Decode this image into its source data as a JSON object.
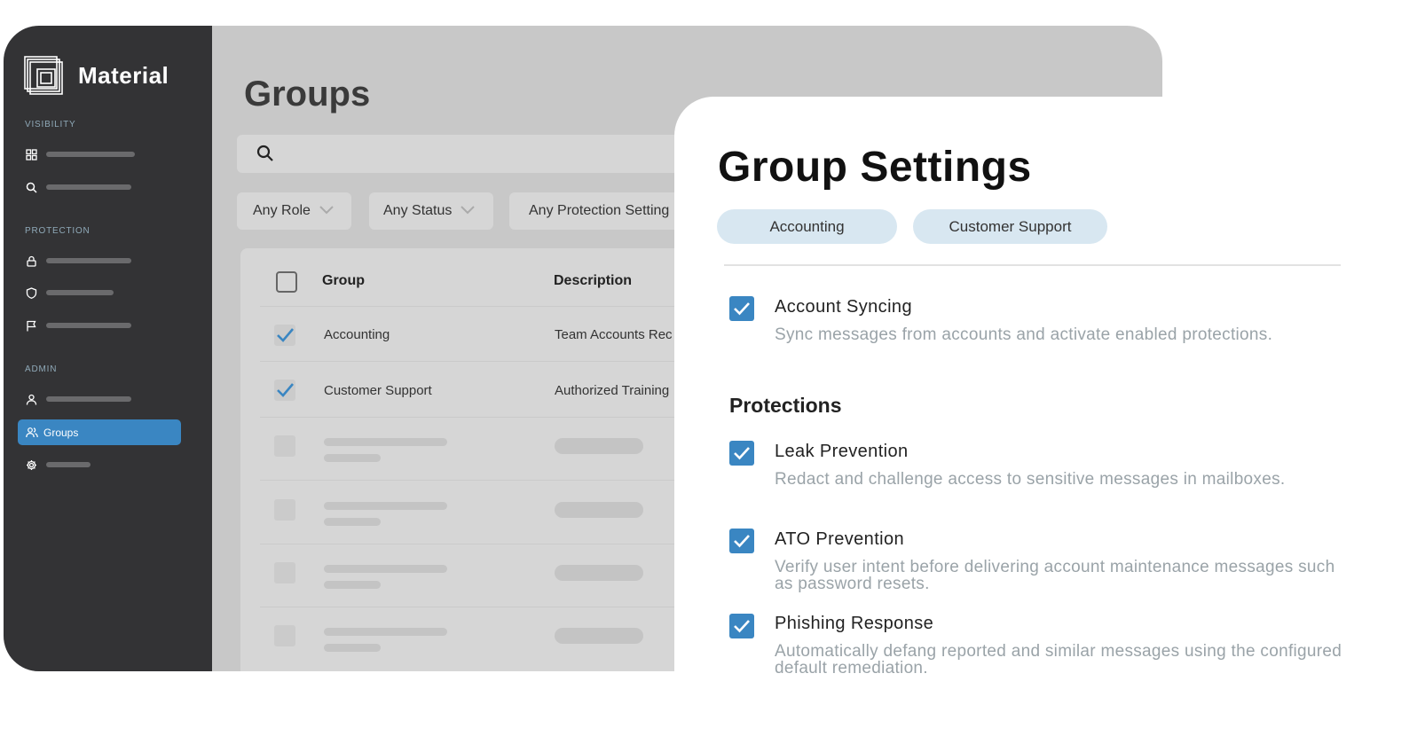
{
  "app": {
    "name": "Material"
  },
  "sidebar": {
    "sections": [
      {
        "label": "VISIBILITY"
      },
      {
        "label": "PROTECTION"
      },
      {
        "label": "ADMIN"
      }
    ],
    "icons": [
      "grid-icon",
      "search-icon",
      "lock-icon",
      "shield-icon",
      "flag-icon",
      "user-icon",
      "groups-icon",
      "gear-icon"
    ],
    "active_item": {
      "label": "Groups",
      "icon": "groups-icon"
    }
  },
  "main": {
    "title": "Groups",
    "filters": [
      "Any Role",
      "Any Status",
      "Any Protection Setting"
    ],
    "table": {
      "columns": [
        "Group",
        "Description"
      ],
      "rows": [
        {
          "group": "Accounting",
          "description": "Team Accounts Rec",
          "checked": true
        },
        {
          "group": "Customer Support",
          "description": "Authorized Training",
          "checked": true
        }
      ]
    }
  },
  "settings": {
    "title": "Group Settings",
    "chips": [
      "Accounting",
      "Customer Support"
    ],
    "account_syncing": {
      "title": "Account Syncing",
      "description": "Sync messages from accounts and activate enabled protections.",
      "checked": true
    },
    "protections_heading": "Protections",
    "protections": [
      {
        "title": "Leak Prevention",
        "description": "Redact and challenge access to sensitive messages in mailboxes.",
        "checked": true
      },
      {
        "title": "ATO Prevention",
        "description": "Verify user intent before delivering account maintenance messages such as password resets.",
        "checked": true
      },
      {
        "title": "Phishing Response",
        "description": "Automatically defang reported and similar messages using the configured default remediation.",
        "checked": true
      }
    ]
  },
  "colors": {
    "accent": "#3a86c2",
    "sidebar": "#333335",
    "chip": "#d8e7f1"
  }
}
